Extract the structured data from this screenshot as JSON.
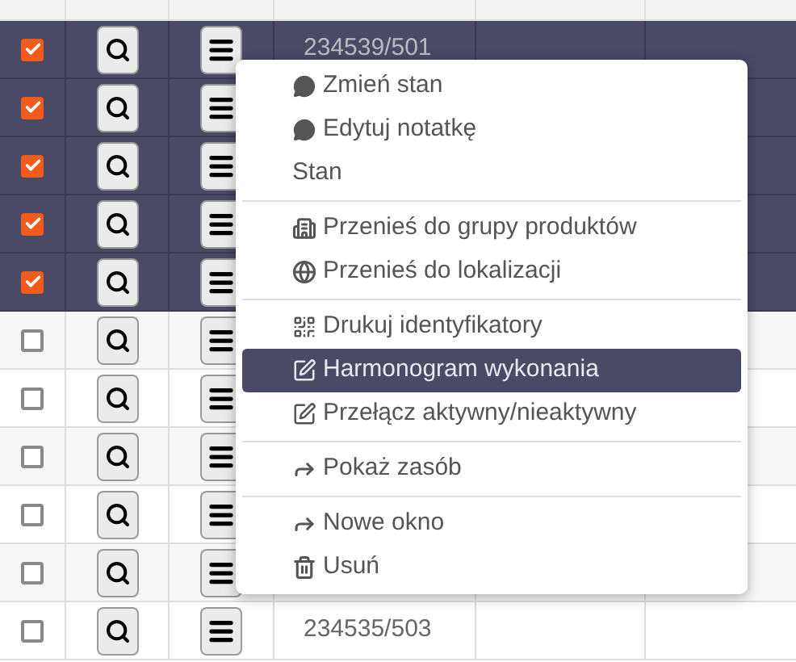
{
  "table": {
    "rows": [
      {
        "checked": true,
        "number": "234539/501"
      },
      {
        "checked": true
      },
      {
        "checked": true
      },
      {
        "checked": true
      },
      {
        "checked": true
      },
      {
        "checked": false
      },
      {
        "checked": false
      },
      {
        "checked": false
      },
      {
        "checked": false
      },
      {
        "checked": false
      },
      {
        "checked": false,
        "number": "234535/503"
      }
    ]
  },
  "context_menu": {
    "groups": [
      {
        "items": [
          {
            "kind": "comment",
            "label": "Zmień stan",
            "selected": false
          },
          {
            "kind": "comment",
            "label": "Edytuj notatkę",
            "selected": false
          },
          {
            "kind": "plain",
            "label": "Stan",
            "selected": false
          }
        ]
      },
      {
        "items": [
          {
            "kind": "building",
            "label": "Przenieś do grupy produktów",
            "selected": false
          },
          {
            "kind": "globe",
            "label": "Przenieś do lokalizacji",
            "selected": false
          }
        ]
      },
      {
        "items": [
          {
            "kind": "qrcode",
            "label": "Drukuj identyfikatory",
            "selected": false
          },
          {
            "kind": "edit",
            "label": "Harmonogram wykonania",
            "selected": true
          },
          {
            "kind": "edit",
            "label": "Przełącz aktywny/nieaktywny",
            "selected": false
          }
        ]
      },
      {
        "items": [
          {
            "kind": "share",
            "label": "Pokaż zasób",
            "selected": false
          }
        ]
      },
      {
        "items": [
          {
            "kind": "share",
            "label": "Nowe okno",
            "selected": false
          },
          {
            "kind": "trash",
            "label": "Usuń",
            "selected": false
          }
        ]
      }
    ]
  }
}
